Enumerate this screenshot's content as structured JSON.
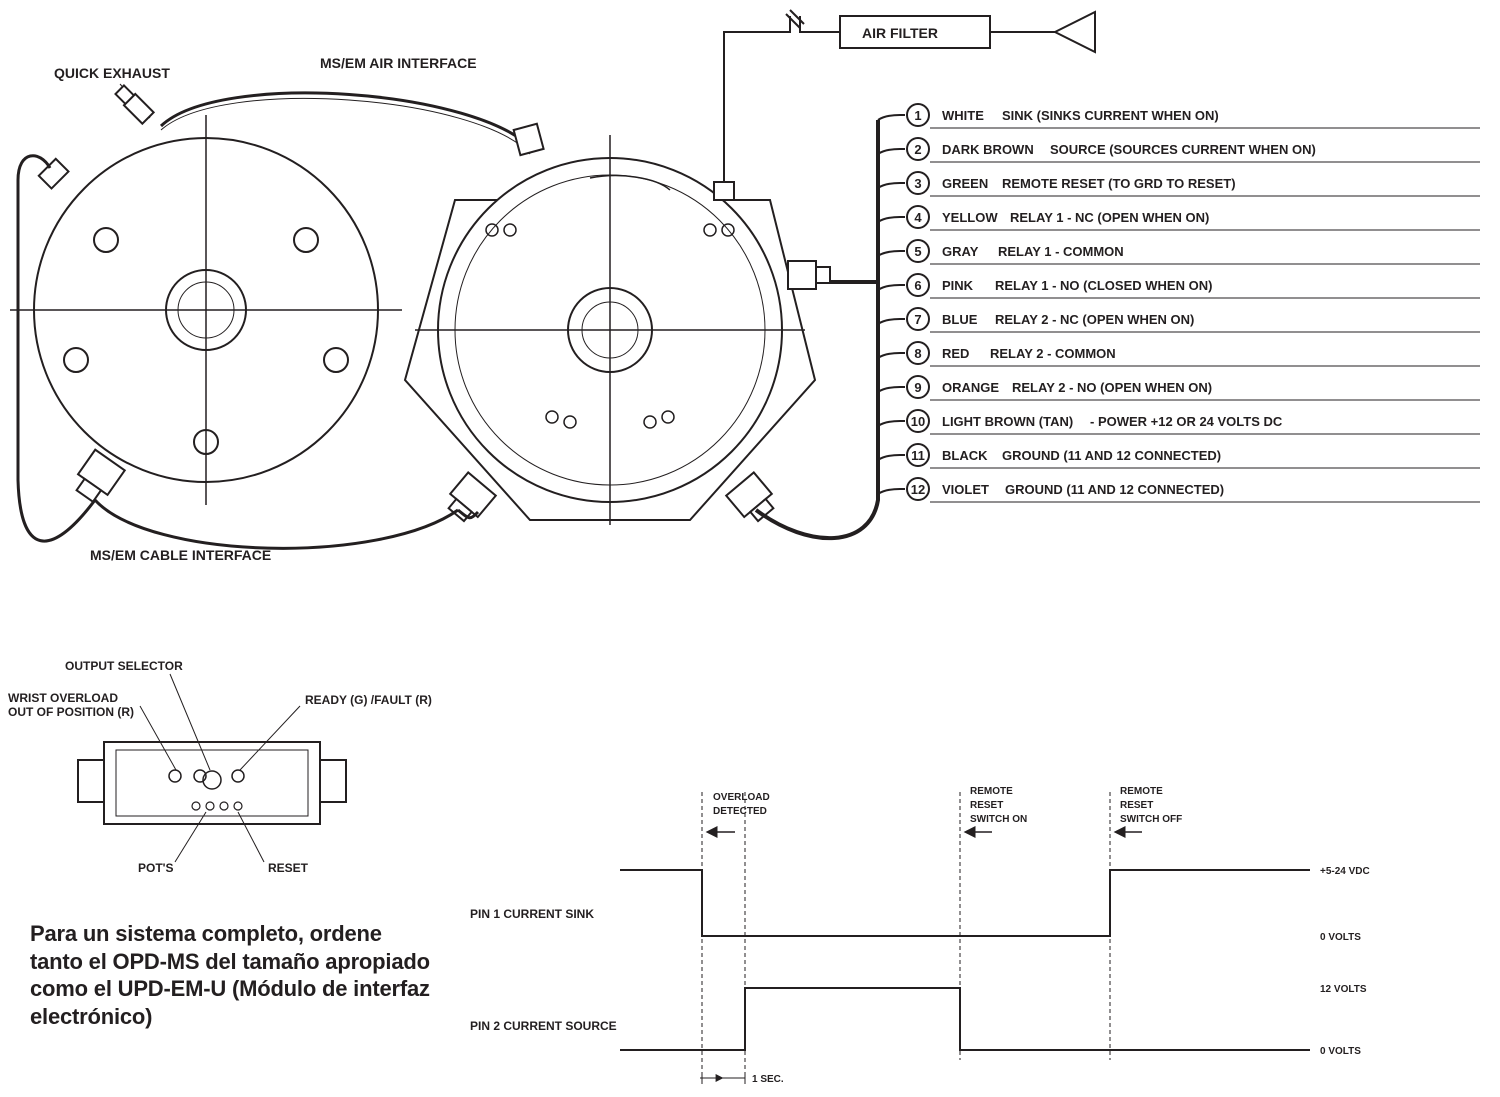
{
  "labels": {
    "airFilter": "AIR FILTER",
    "msEmAir": "MS/EM AIR INTERFACE",
    "quickExhaust": "QUICK EXHAUST",
    "msEmCable": "MS/EM CABLE INTERFACE",
    "outputSelector": "OUTPUT SELECTOR",
    "wristOverload1": "WRIST OVERLOAD",
    "wristOverload2": "OUT OF POSITION (R)",
    "readyFault": "READY (G) /FAULT (R)",
    "pots": "POT'S",
    "reset": "RESET",
    "spanish": "Para un sistema completo, ordene tanto el OPD-MS del tamaño apropiado como el UPD-EM-U (Módulo de interfaz electrónico)"
  },
  "pins": [
    {
      "num": "1",
      "color": "WHITE",
      "desc": "SINK (SINKS CURRENT WHEN ON)"
    },
    {
      "num": "2",
      "color": "DARK BROWN",
      "desc": "SOURCE (SOURCES CURRENT WHEN ON)"
    },
    {
      "num": "3",
      "color": "GREEN",
      "desc": "REMOTE RESET (TO GRD TO RESET)"
    },
    {
      "num": "4",
      "color": "YELLOW",
      "desc": "RELAY 1 - NC (OPEN WHEN ON)"
    },
    {
      "num": "5",
      "color": "GRAY",
      "desc": "RELAY 1 - COMMON"
    },
    {
      "num": "6",
      "color": "PINK",
      "desc": "RELAY 1 - NO (CLOSED WHEN ON)"
    },
    {
      "num": "7",
      "color": "BLUE",
      "desc": "RELAY 2 - NC (OPEN WHEN ON)"
    },
    {
      "num": "8",
      "color": "RED",
      "desc": "RELAY 2 - COMMON"
    },
    {
      "num": "9",
      "color": "ORANGE",
      "desc": "RELAY 2 - NO (OPEN WHEN ON)"
    },
    {
      "num": "10",
      "color": "LIGHT BROWN (TAN)",
      "desc": "- POWER +12 OR 24 VOLTS DC"
    },
    {
      "num": "11",
      "color": "BLACK",
      "desc": "GROUND (11 AND 12 CONNECTED)"
    },
    {
      "num": "12",
      "color": "VIOLET",
      "desc": "GROUND (11 AND 12 CONNECTED)"
    }
  ],
  "timing": {
    "overload": "OVERLOAD",
    "detected": "DETECTED",
    "remote": "REMOTE",
    "reset": "RESET",
    "switchOn": "SWITCH ON",
    "switchOff": "SWITCH OFF",
    "pin1": "PIN 1 CURRENT SINK",
    "pin2": "PIN 2 CURRENT SOURCE",
    "v524": "+5-24 VDC",
    "v0": "0 VOLTS",
    "v12": "12 VOLTS",
    "sec1": "1 SEC."
  }
}
